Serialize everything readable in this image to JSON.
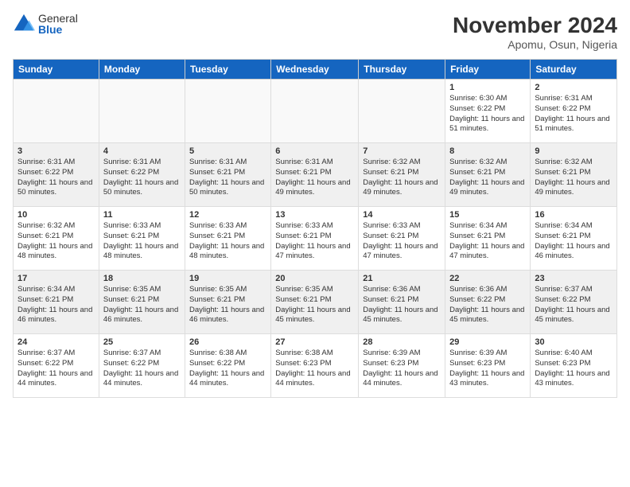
{
  "logo": {
    "general": "General",
    "blue": "Blue"
  },
  "title": "November 2024",
  "location": "Apomu, Osun, Nigeria",
  "days_of_week": [
    "Sunday",
    "Monday",
    "Tuesday",
    "Wednesday",
    "Thursday",
    "Friday",
    "Saturday"
  ],
  "weeks": [
    [
      {
        "day": "",
        "detail": ""
      },
      {
        "day": "",
        "detail": ""
      },
      {
        "day": "",
        "detail": ""
      },
      {
        "day": "",
        "detail": ""
      },
      {
        "day": "",
        "detail": ""
      },
      {
        "day": "1",
        "detail": "Sunrise: 6:30 AM\nSunset: 6:22 PM\nDaylight: 11 hours\nand 51 minutes."
      },
      {
        "day": "2",
        "detail": "Sunrise: 6:31 AM\nSunset: 6:22 PM\nDaylight: 11 hours\nand 51 minutes."
      }
    ],
    [
      {
        "day": "3",
        "detail": "Sunrise: 6:31 AM\nSunset: 6:22 PM\nDaylight: 11 hours\nand 50 minutes."
      },
      {
        "day": "4",
        "detail": "Sunrise: 6:31 AM\nSunset: 6:22 PM\nDaylight: 11 hours\nand 50 minutes."
      },
      {
        "day": "5",
        "detail": "Sunrise: 6:31 AM\nSunset: 6:21 PM\nDaylight: 11 hours\nand 50 minutes."
      },
      {
        "day": "6",
        "detail": "Sunrise: 6:31 AM\nSunset: 6:21 PM\nDaylight: 11 hours\nand 49 minutes."
      },
      {
        "day": "7",
        "detail": "Sunrise: 6:32 AM\nSunset: 6:21 PM\nDaylight: 11 hours\nand 49 minutes."
      },
      {
        "day": "8",
        "detail": "Sunrise: 6:32 AM\nSunset: 6:21 PM\nDaylight: 11 hours\nand 49 minutes."
      },
      {
        "day": "9",
        "detail": "Sunrise: 6:32 AM\nSunset: 6:21 PM\nDaylight: 11 hours\nand 49 minutes."
      }
    ],
    [
      {
        "day": "10",
        "detail": "Sunrise: 6:32 AM\nSunset: 6:21 PM\nDaylight: 11 hours\nand 48 minutes."
      },
      {
        "day": "11",
        "detail": "Sunrise: 6:33 AM\nSunset: 6:21 PM\nDaylight: 11 hours\nand 48 minutes."
      },
      {
        "day": "12",
        "detail": "Sunrise: 6:33 AM\nSunset: 6:21 PM\nDaylight: 11 hours\nand 48 minutes."
      },
      {
        "day": "13",
        "detail": "Sunrise: 6:33 AM\nSunset: 6:21 PM\nDaylight: 11 hours\nand 47 minutes."
      },
      {
        "day": "14",
        "detail": "Sunrise: 6:33 AM\nSunset: 6:21 PM\nDaylight: 11 hours\nand 47 minutes."
      },
      {
        "day": "15",
        "detail": "Sunrise: 6:34 AM\nSunset: 6:21 PM\nDaylight: 11 hours\nand 47 minutes."
      },
      {
        "day": "16",
        "detail": "Sunrise: 6:34 AM\nSunset: 6:21 PM\nDaylight: 11 hours\nand 46 minutes."
      }
    ],
    [
      {
        "day": "17",
        "detail": "Sunrise: 6:34 AM\nSunset: 6:21 PM\nDaylight: 11 hours\nand 46 minutes."
      },
      {
        "day": "18",
        "detail": "Sunrise: 6:35 AM\nSunset: 6:21 PM\nDaylight: 11 hours\nand 46 minutes."
      },
      {
        "day": "19",
        "detail": "Sunrise: 6:35 AM\nSunset: 6:21 PM\nDaylight: 11 hours\nand 46 minutes."
      },
      {
        "day": "20",
        "detail": "Sunrise: 6:35 AM\nSunset: 6:21 PM\nDaylight: 11 hours\nand 45 minutes."
      },
      {
        "day": "21",
        "detail": "Sunrise: 6:36 AM\nSunset: 6:21 PM\nDaylight: 11 hours\nand 45 minutes."
      },
      {
        "day": "22",
        "detail": "Sunrise: 6:36 AM\nSunset: 6:22 PM\nDaylight: 11 hours\nand 45 minutes."
      },
      {
        "day": "23",
        "detail": "Sunrise: 6:37 AM\nSunset: 6:22 PM\nDaylight: 11 hours\nand 45 minutes."
      }
    ],
    [
      {
        "day": "24",
        "detail": "Sunrise: 6:37 AM\nSunset: 6:22 PM\nDaylight: 11 hours\nand 44 minutes."
      },
      {
        "day": "25",
        "detail": "Sunrise: 6:37 AM\nSunset: 6:22 PM\nDaylight: 11 hours\nand 44 minutes."
      },
      {
        "day": "26",
        "detail": "Sunrise: 6:38 AM\nSunset: 6:22 PM\nDaylight: 11 hours\nand 44 minutes."
      },
      {
        "day": "27",
        "detail": "Sunrise: 6:38 AM\nSunset: 6:23 PM\nDaylight: 11 hours\nand 44 minutes."
      },
      {
        "day": "28",
        "detail": "Sunrise: 6:39 AM\nSunset: 6:23 PM\nDaylight: 11 hours\nand 44 minutes."
      },
      {
        "day": "29",
        "detail": "Sunrise: 6:39 AM\nSunset: 6:23 PM\nDaylight: 11 hours\nand 43 minutes."
      },
      {
        "day": "30",
        "detail": "Sunrise: 6:40 AM\nSunset: 6:23 PM\nDaylight: 11 hours\nand 43 minutes."
      }
    ]
  ]
}
